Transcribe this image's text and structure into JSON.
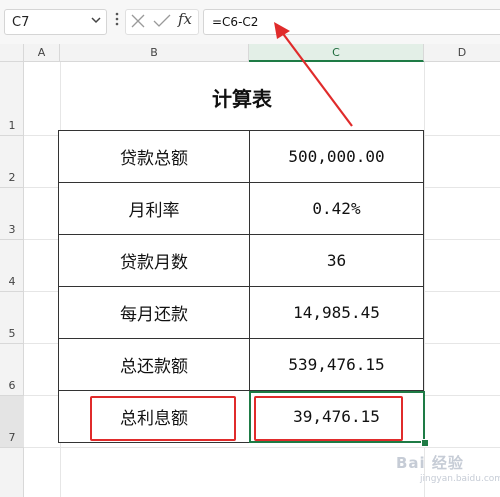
{
  "formula_bar": {
    "name_box": "C7",
    "formula": "=C6-C2",
    "fx_label": "fx"
  },
  "columns": [
    "A",
    "B",
    "C",
    "D"
  ],
  "rows": [
    "1",
    "2",
    "3",
    "4",
    "5",
    "6",
    "7"
  ],
  "sheet": {
    "title": "计算表",
    "table": [
      {
        "label": "贷款总额",
        "value": "500,000.00"
      },
      {
        "label": "月利率",
        "value": "0.42%"
      },
      {
        "label": "贷款月数",
        "value": "36"
      },
      {
        "label": "每月还款",
        "value": "14,985.45"
      },
      {
        "label": "总还款额",
        "value": "539,476.15"
      },
      {
        "label": "总利息额",
        "value": "39,476.15"
      }
    ]
  },
  "colors": {
    "selection": "#1e7b45",
    "annotation": "#e02b2b"
  },
  "watermark": {
    "text": "Bai 经验",
    "sub": "jingyan.baidu.com"
  }
}
